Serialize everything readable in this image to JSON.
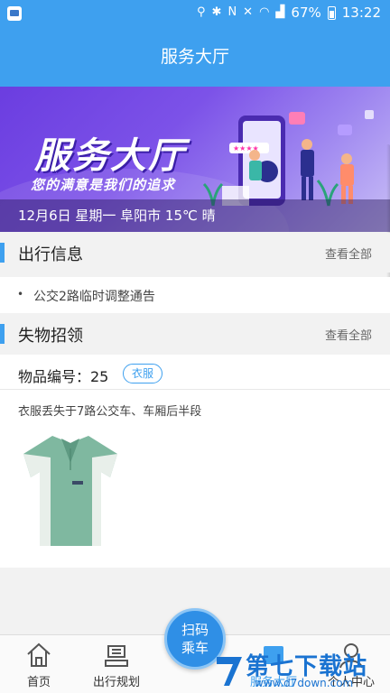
{
  "status_bar": {
    "battery": "67%",
    "time": "13:22",
    "icons": [
      "location-icon",
      "bluetooth-icon",
      "nfc-icon",
      "mute-icon",
      "wifi-icon",
      "signal-icon",
      "battery-icon"
    ]
  },
  "header": {
    "title": "服务大厅"
  },
  "banner": {
    "title": "服务大厅",
    "slogan": "您的满意是我们的追求",
    "weather": "12月6日 星期一 阜阳市 15℃ 晴"
  },
  "travel_info": {
    "title": "出行信息",
    "more": "查看全部",
    "items": [
      "公交2路临时调整通告"
    ]
  },
  "lost_found": {
    "title": "失物招领",
    "more": "查看全部",
    "item_number": "物品编号：25",
    "category": "衣服",
    "description": "衣服丢失于7路公交车、车厢后半段",
    "image": "green-polo-shirt"
  },
  "bottom_nav": {
    "items": [
      {
        "label": "首页",
        "icon": "home-icon"
      },
      {
        "label": "出行规划",
        "icon": "route-icon"
      },
      {
        "label": "服务大厅",
        "icon": "service-icon"
      },
      {
        "label": "个人中心",
        "icon": "user-icon"
      }
    ],
    "scan": {
      "line1": "扫码",
      "line2": "乘车"
    }
  },
  "watermark": {
    "main": "第七下载站",
    "sub": "www.d7down.com"
  },
  "colors": {
    "primary": "#3ea0ef",
    "banner": "#6b3de0"
  }
}
